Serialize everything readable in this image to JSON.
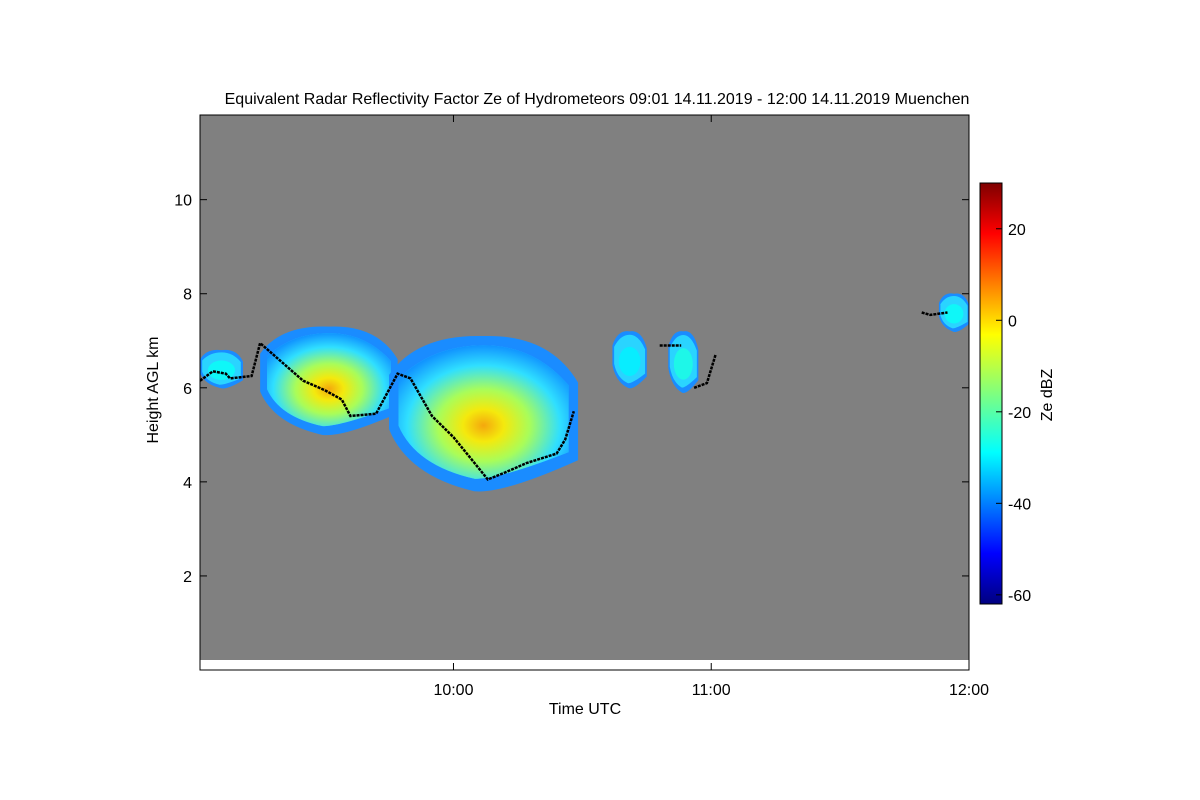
{
  "chart_data": {
    "type": "heatmap",
    "title": "Equivalent Radar Reflectivity Factor Ze of Hydrometeors   09:01 14.11.2019 - 12:00 14.11.2019 Muenchen",
    "xlabel": "Time UTC",
    "ylabel": "Height AGL km",
    "xlim": [
      "09:01",
      "12:00"
    ],
    "ylim": [
      0,
      11.8
    ],
    "xticks": [
      "10:00",
      "11:00",
      "12:00"
    ],
    "yticks": [
      2,
      4,
      6,
      8,
      10
    ],
    "colorbar": {
      "label": "Ze dBZ",
      "range": [
        -62,
        30
      ],
      "ticks": [
        -60,
        -40,
        -20,
        0,
        20
      ],
      "colormap": "jet"
    },
    "background_color": "#808080",
    "cloud_regions": [
      {
        "t_start": "09:01",
        "t_end": "09:11",
        "base_km": 6.0,
        "top_km": 6.8,
        "peak_dbz": -28
      },
      {
        "t_start": "09:15",
        "t_end": "09:47",
        "base_km": 5.0,
        "top_km": 7.3,
        "peak_dbz": -14
      },
      {
        "t_start": "09:45",
        "t_end": "10:29",
        "base_km": 3.8,
        "top_km": 7.1,
        "peak_dbz": -2
      },
      {
        "t_start": "10:37",
        "t_end": "10:45",
        "base_km": 6.0,
        "top_km": 7.2,
        "peak_dbz": -30
      },
      {
        "t_start": "10:50",
        "t_end": "10:57",
        "base_km": 5.9,
        "top_km": 7.2,
        "peak_dbz": -26
      },
      {
        "t_start": "11:53",
        "t_end": "12:00",
        "base_km": 7.2,
        "top_km": 8.0,
        "peak_dbz": -28
      }
    ],
    "cloud_base_line": [
      {
        "t": "09:01",
        "h": 6.15
      },
      {
        "t": "09:04",
        "h": 6.35
      },
      {
        "t": "09:07",
        "h": 6.3
      },
      {
        "t": "09:08",
        "h": 6.2
      },
      {
        "t": "09:13",
        "h": 6.25
      },
      {
        "t": "09:15",
        "h": 6.95
      },
      {
        "t": "09:20",
        "h": 6.55
      },
      {
        "t": "09:25",
        "h": 6.15
      },
      {
        "t": "09:30",
        "h": 5.95
      },
      {
        "t": "09:34",
        "h": 5.75
      },
      {
        "t": "09:36",
        "h": 5.4
      },
      {
        "t": "09:42",
        "h": 5.45
      },
      {
        "t": "09:47",
        "h": 6.3
      },
      {
        "t": "09:50",
        "h": 6.2
      },
      {
        "t": "09:55",
        "h": 5.4
      },
      {
        "t": "10:00",
        "h": 4.95
      },
      {
        "t": "10:04",
        "h": 4.5
      },
      {
        "t": "10:08",
        "h": 4.05
      },
      {
        "t": "10:12",
        "h": 4.2
      },
      {
        "t": "10:17",
        "h": 4.4
      },
      {
        "t": "10:24",
        "h": 4.6
      },
      {
        "t": "10:26",
        "h": 4.9
      },
      {
        "t": "10:28",
        "h": 5.5
      }
    ],
    "extra_lines": [
      [
        {
          "t": "10:48",
          "h": 6.9
        },
        {
          "t": "10:53",
          "h": 6.9
        }
      ],
      [
        {
          "t": "10:56",
          "h": 6.0
        },
        {
          "t": "10:59",
          "h": 6.1
        },
        {
          "t": "11:01",
          "h": 6.7
        }
      ],
      [
        {
          "t": "11:49",
          "h": 7.6
        },
        {
          "t": "11:51",
          "h": 7.55
        },
        {
          "t": "11:55",
          "h": 7.6
        }
      ]
    ]
  }
}
